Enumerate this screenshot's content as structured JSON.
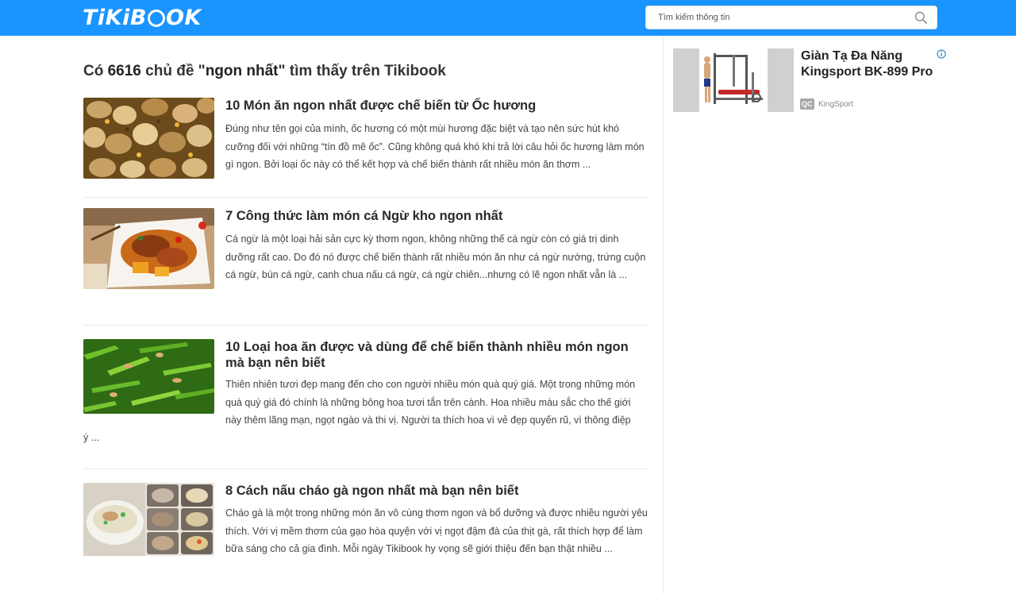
{
  "header": {
    "logo_text_a": "TiKiB",
    "logo_text_b": "OK",
    "search_placeholder": "Tìm kiếm thông tin"
  },
  "results": {
    "prefix": "Có ",
    "count": "6616",
    "middle": " chủ đề \"",
    "query": "ngon nhất",
    "suffix": "\" tìm thấy trên Tikibook"
  },
  "articles": [
    {
      "title": "10 Món ăn ngon nhất được chế biến từ Ốc hương",
      "excerpt": "Đúng như tên gọi của mình, ốc hương có một mùi hương đặc biệt và tạo nên sức hút khó cưỡng đối với những “tín đồ mê ốc”. Cũng không quá khó khi trả lời câu hỏi ốc hương làm món gì ngon. Bởi loại ốc này có thể kết hợp và chế biến thành rất nhiều món ăn thơm ..."
    },
    {
      "title": "7 Công thức làm món cá Ngừ kho ngon nhất",
      "excerpt": "Cá ngừ là một loại hải sản cực kỳ thơm ngon, không những thế cá ngừ còn có giá trị dinh dưỡng rất cao. Do đó nó được chế biến thành rất nhiều món ăn như cá ngừ nướng, trứng cuộn cá ngừ, bún cá ngừ, canh chua nấu cá ngừ, cá ngừ chiên...nhưng có lẽ ngon nhất vẫn là ..."
    },
    {
      "title": "10 Loại hoa ăn được và dùng để chế biến thành nhiều món ngon mà bạn nên biết",
      "excerpt_main": "Thiên nhiên tươi đẹp mang đến cho con người nhiều món quà quý giá. Một trong những món quà quý giá đó chính là những bông hoa tươi tắn trên cành. Hoa nhiều màu sắc cho thế giới này thêm lãng mạn, ngọt ngào và thi vị. Người ta thích hoa vì vẻ đẹp quyến rũ, vì thông điệp",
      "excerpt_tail": "ý ..."
    },
    {
      "title": "8 Cách nấu cháo gà ngon nhất mà bạn nên biết",
      "excerpt": "Cháo gà là một trong những món ăn vô cùng thơm ngon và bổ dưỡng và được nhiều người yêu thích. Với vị mềm thơm của gạo hòa quyện với vị ngọt đậm đà của thịt gà, rất thích hợp để làm bữa sáng cho cả gia đình. Mỗi ngày Tikibook hy vọng sẽ giới thiệu đến bạn thật nhiều ..."
    }
  ],
  "ad": {
    "title": "Giàn Tạ Đa Năng Kingsport BK-899 Pro",
    "badge": "QC",
    "brand": "KingSport"
  },
  "colors": {
    "brand_blue": "#1a94ff"
  }
}
